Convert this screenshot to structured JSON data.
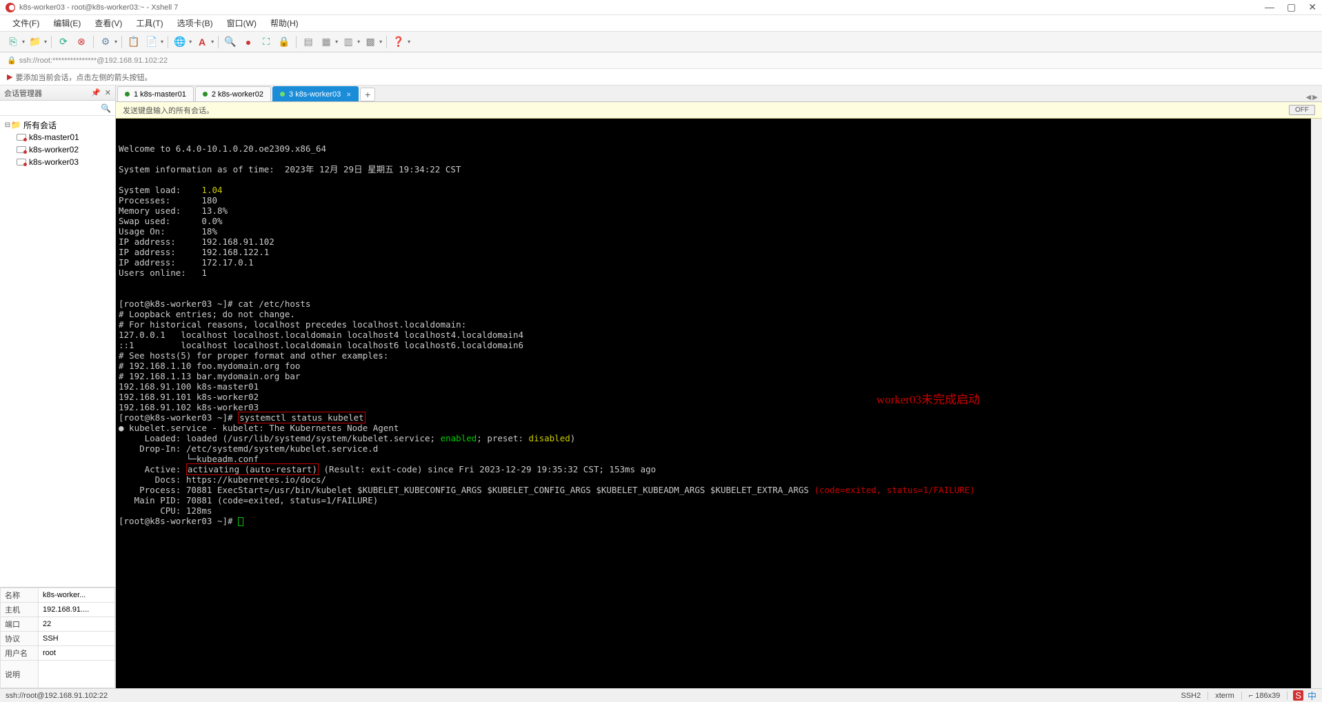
{
  "window": {
    "title": "k8s-worker03 - root@k8s-worker03:~ - Xshell 7"
  },
  "menu": {
    "file": "文件(F)",
    "edit": "编辑(E)",
    "view": "查看(V)",
    "tools": "工具(T)",
    "tab": "选项卡(B)",
    "window": "窗口(W)",
    "help": "帮助(H)"
  },
  "address": "ssh://root:***************@192.168.91.102:22",
  "hint": "要添加当前会话，点击左侧的箭头按钮。",
  "sidebar": {
    "title": "会话管理器",
    "root": "所有会话",
    "items": [
      "k8s-master01",
      "k8s-worker02",
      "k8s-worker03"
    ]
  },
  "props": {
    "name_l": "名称",
    "name_v": "k8s-worker...",
    "host_l": "主机",
    "host_v": "192.168.91....",
    "port_l": "端口",
    "port_v": "22",
    "proto_l": "协议",
    "proto_v": "SSH",
    "user_l": "用户名",
    "user_v": "root",
    "desc_l": "说明",
    "desc_v": ""
  },
  "tabs": [
    {
      "label": "1 k8s-master01",
      "active": false
    },
    {
      "label": "2 k8s-worker02",
      "active": false
    },
    {
      "label": "3 k8s-worker03",
      "active": true
    }
  ],
  "broadcast": {
    "text": "发送键盘输入的所有会话。",
    "btn": "OFF"
  },
  "terminal": {
    "welcome": "Welcome to 6.4.0-10.1.0.20.oe2309.x86_64",
    "sysinfo": "System information as of time:  2023年 12月 29日 星期五 19:34:22 CST",
    "block1": [
      {
        "k": "System load:",
        "v": "1.04",
        "yellow": true
      },
      {
        "k": "Processes:",
        "v": "180"
      },
      {
        "k": "Memory used:",
        "v": "13.8%"
      },
      {
        "k": "Swap used:",
        "v": "0.0%"
      },
      {
        "k": "Usage On:",
        "v": "18%"
      },
      {
        "k": "IP address:",
        "v": "192.168.91.102"
      },
      {
        "k": "IP address:",
        "v": "192.168.122.1"
      },
      {
        "k": "IP address:",
        "v": "172.17.0.1"
      },
      {
        "k": "Users online:",
        "v": "1"
      }
    ],
    "prompt1": "[root@k8s-worker03 ~]# ",
    "cmd1": "cat /etc/hosts",
    "hosts": [
      "# Loopback entries; do not change.",
      "# For historical reasons, localhost precedes localhost.localdomain:",
      "127.0.0.1   localhost localhost.localdomain localhost4 localhost4.localdomain4",
      "::1         localhost localhost.localdomain localhost6 localhost6.localdomain6",
      "# See hosts(5) for proper format and other examples:",
      "# 192.168.1.10 foo.mydomain.org foo",
      "# 192.168.1.13 bar.mydomain.org bar",
      "192.168.91.100 k8s-master01",
      "192.168.91.101 k8s-worker02",
      "192.168.91.102 k8s-worker03"
    ],
    "prompt2": "[root@k8s-worker03 ~]# ",
    "cmd2": "systemctl status kubelet",
    "svc_head": "● kubelet.service - kubelet: The Kubernetes Node Agent",
    "svc_loaded_a": "     Loaded: loaded (/usr/lib/systemd/system/kubelet.service; ",
    "svc_loaded_en": "enabled",
    "svc_loaded_b": "; preset: ",
    "svc_loaded_dis": "disabled",
    "svc_loaded_c": ")",
    "svc_dropin1": "    Drop-In: /etc/systemd/system/kubelet.service.d",
    "svc_dropin2": "             └─kubeadm.conf",
    "svc_active_a": "     Active: ",
    "svc_active_state": "activating (auto-restart)",
    "svc_active_b": " (Result: exit-code) since Fri 2023-12-29 19:35:32 CST; 153ms ago",
    "svc_docs": "       Docs: https://kubernetes.io/docs/",
    "svc_proc_a": "    Process: 70881 ExecStart=/usr/bin/kubelet $KUBELET_KUBECONFIG_ARGS $KUBELET_CONFIG_ARGS $KUBELET_KUBEADM_ARGS $KUBELET_EXTRA_ARGS ",
    "svc_proc_b": "(code=exited, status=1/FAILURE)",
    "svc_pid": "   Main PID: 70881 (code=exited, status=1/FAILURE)",
    "svc_cpu": "        CPU: 128ms",
    "prompt3": "[root@k8s-worker03 ~]# ",
    "annotation": "worker03未完成启动"
  },
  "status": {
    "left": "ssh://root@192.168.91.102:22",
    "s1": "SSH2",
    "s2": "xterm",
    "s3": "⌐ 186x39",
    "tray": "中"
  }
}
